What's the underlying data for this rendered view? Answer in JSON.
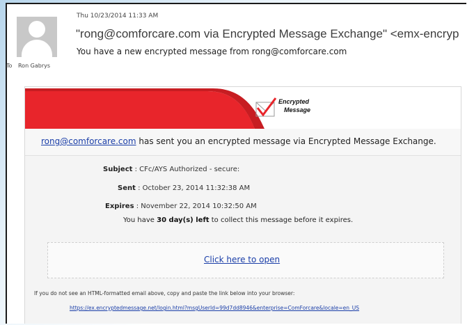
{
  "header": {
    "date": "Thu 10/23/2014 11:33 AM",
    "sender": "\"rong@comforcare.com via Encrypted Message Exchange\" <emx-encryp",
    "subject": "You have a new encrypted message from rong@comforcare.com",
    "to_label": "To",
    "to_name": "Ron Gabrys"
  },
  "banner": {
    "logo_line1": "Encrypted",
    "logo_line2": "Message",
    "brand_red": "#e8252b"
  },
  "message": {
    "sender_link": "rong@comforcare.com",
    "intro_text": " has sent you an encrypted message via Encrypted Message Exchange.",
    "subject_label": "Subject",
    "subject_value": "CFc/AYS Authorized - secure:",
    "sent_label": "Sent",
    "sent_value": "October 23, 2014 11:32:38 AM",
    "expires_label": "Expires",
    "expires_value": "November 22, 2014 10:32:50 AM",
    "remain_prefix": "You have ",
    "remain_days": "30 day(s) left",
    "remain_suffix": " to collect this message before it expires.",
    "open_link": "Click here to open",
    "fallback_note": "If you do not see an HTML-formatted email above, copy and paste the link below into your browser:",
    "fallback_url": "https://ex.encryptedmessage.net/login.html?msgUserId=99d7dd8946&enterprise=ComForcare&locale=en_US"
  }
}
